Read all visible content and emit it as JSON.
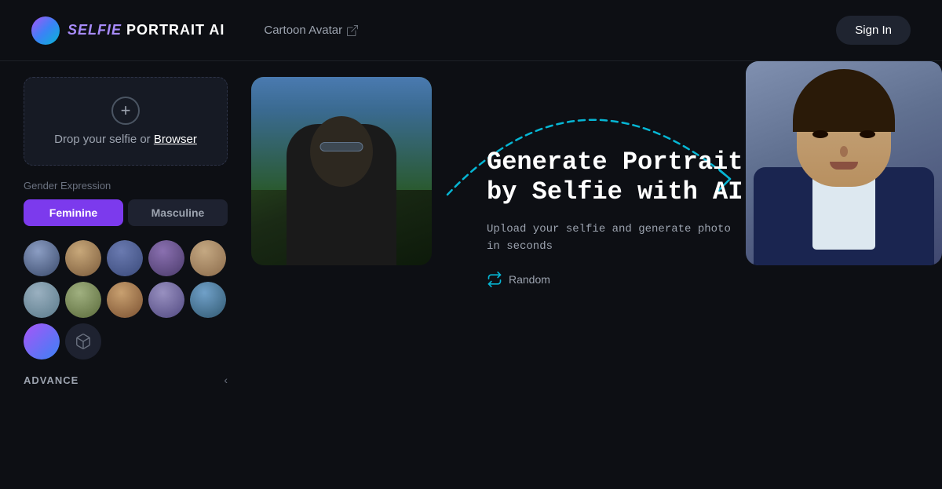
{
  "header": {
    "logo": {
      "selfie": "SELFIE",
      "portrait": " PORTRAIT",
      "ai": " AI"
    },
    "nav": {
      "cartoon_avatar": "Cartoon Avatar"
    },
    "signin_label": "Sign In"
  },
  "upload": {
    "plus_icon": "+",
    "text_prefix": "Drop your selfie or ",
    "browser_link": "Browser"
  },
  "gender": {
    "label": "Gender Expression",
    "options": [
      "Feminine",
      "Masculine"
    ],
    "active": "Feminine"
  },
  "avatars": {
    "row1": [
      "av1",
      "av2",
      "av3",
      "av4",
      "av5",
      "av6"
    ],
    "row2": [
      "av7",
      "av8",
      "av9",
      "av10",
      "av11",
      "av-3d"
    ]
  },
  "advance": {
    "label": "ADVANCE"
  },
  "hero": {
    "title_line1": "Generate Portrait",
    "title_line2": "by Selfie with AI",
    "subtitle": "Upload your selfie and generate photo\nin seconds",
    "random_label": "Random"
  },
  "colors": {
    "accent_purple": "#7c3aed",
    "accent_cyan": "#06b6d4",
    "background": "#0d0f14",
    "panel_bg": "#161a24",
    "text_muted": "#9ca3af"
  }
}
